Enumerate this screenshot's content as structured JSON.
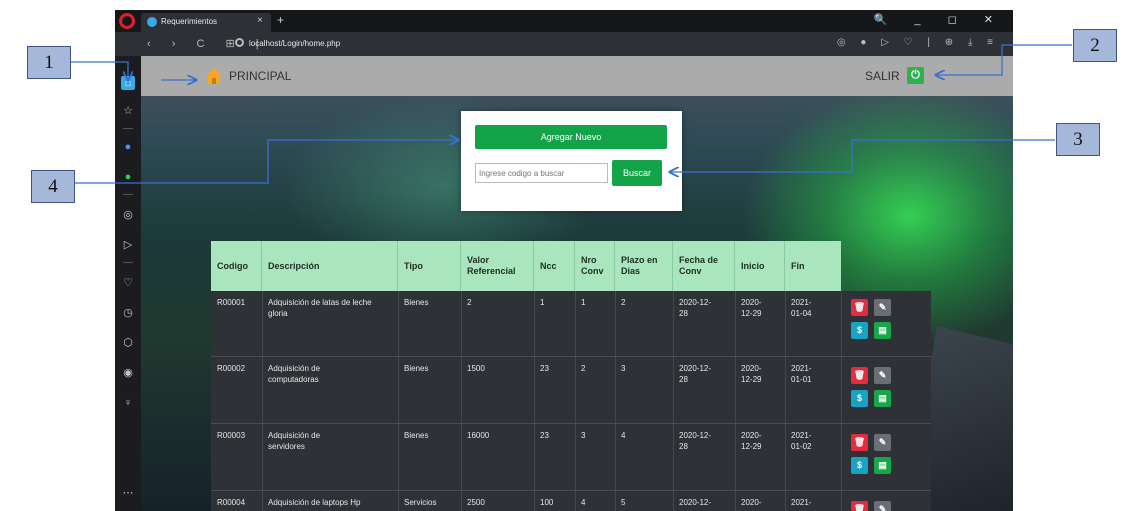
{
  "browser": {
    "tab_title": "Requerimientos",
    "tab_close": "×",
    "new_tab": "+",
    "window_controls": "🔍 _ ◻ ✕",
    "nav_icons": "‹ › C ⊞ |",
    "url": "localhost/Login/home.php"
  },
  "header": {
    "principal_label": "PRINCIPAL",
    "salir_label": "SALIR"
  },
  "search_card": {
    "add_button": "Agregar Nuevo",
    "search_placeholder": "Ingrese codigo a buscar",
    "search_button": "Buscar"
  },
  "table": {
    "headers": [
      "Codigo",
      "Descripción",
      "Tipo",
      "Valor Referencial",
      "Ncc",
      "Nro Conv",
      "Plazo en Dias",
      "Fecha de Conv",
      "Inicio",
      "Fin"
    ],
    "rows": [
      {
        "codigo": "R00001",
        "descripcion": "Adquisición de latas de leche gloria",
        "tipo": "Bienes",
        "valor": "2",
        "ncc": "1",
        "nro": "1",
        "plazo": "2",
        "fecha": "2020-12-28",
        "inicio": "2020-12-29",
        "fin": "2021-01-04"
      },
      {
        "codigo": "R00002",
        "descripcion": "Adquisición de computadoras",
        "tipo": "Bienes",
        "valor": "1500",
        "ncc": "23",
        "nro": "2",
        "plazo": "3",
        "fecha": "2020-12-28",
        "inicio": "2020-12-29",
        "fin": "2021-01-01"
      },
      {
        "codigo": "R00003",
        "descripcion": "Adquisición de servidores",
        "tipo": "Bienes",
        "valor": "16000",
        "ncc": "23",
        "nro": "3",
        "plazo": "4",
        "fecha": "2020-12-28",
        "inicio": "2020-12-29",
        "fin": "2021-01-02"
      },
      {
        "codigo": "R00004",
        "descripcion": "Adquisición de laptops Hp",
        "tipo": "Servicios",
        "valor": "2500",
        "ncc": "100",
        "nro": "4",
        "plazo": "5",
        "fecha": "2020-12-",
        "inicio": "2020-",
        "fin": "2021-"
      }
    ],
    "action_icons": {
      "delete": "🗑",
      "edit": "✎",
      "pay": "$",
      "doc": "▤"
    }
  },
  "annotations": [
    "1",
    "2",
    "3",
    "4"
  ],
  "colors": {
    "accent_green": "#13a44a",
    "table_header": "#a9e5bd",
    "table_body": "#2e3136",
    "delete_red": "#e52b3f",
    "pay_blue": "#18a2c4",
    "annotation_fill": "#a6b8d9"
  }
}
